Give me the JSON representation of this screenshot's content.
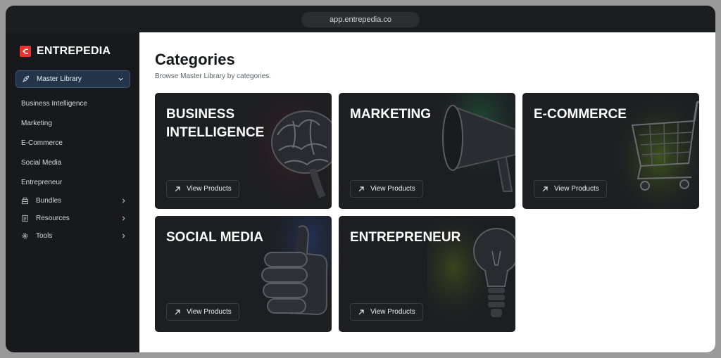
{
  "browser": {
    "url": "app.entrepedia.co"
  },
  "sidebar": {
    "brand": "ENTREPEDIA",
    "active_item": "Master Library",
    "items": [
      "Business Intelligence",
      "Marketing",
      "E-Commerce",
      "Social Media",
      "Entrepreneur"
    ],
    "groups": [
      {
        "label": "Bundles",
        "icon": "box-icon"
      },
      {
        "label": "Resources",
        "icon": "document-icon"
      },
      {
        "label": "Tools",
        "icon": "gear-icon"
      }
    ]
  },
  "main": {
    "title": "Categories",
    "subtitle": "Browse Master Library by categories.",
    "cards": [
      {
        "title": "BUSINESS INTELLIGENCE",
        "button": "View Products",
        "art": "brain-icon",
        "glow": "#5a2226"
      },
      {
        "title": "MARKETING",
        "button": "View Products",
        "art": "megaphone-icon",
        "glow": "#1f5a3d"
      },
      {
        "title": "E-COMMERCE",
        "button": "View Products",
        "art": "shopping-cart-icon",
        "glow": "#4c6a1a"
      },
      {
        "title": "SOCIAL MEDIA",
        "button": "View Products",
        "art": "thumbs-up-icon",
        "glow": "#24365e"
      },
      {
        "title": "ENTREPRENEUR",
        "button": "View Products",
        "art": "lightbulb-icon",
        "glow": "#4a5a1c"
      }
    ]
  },
  "colors": {
    "accent": "#e8352f",
    "active_nav": "#24344a"
  }
}
